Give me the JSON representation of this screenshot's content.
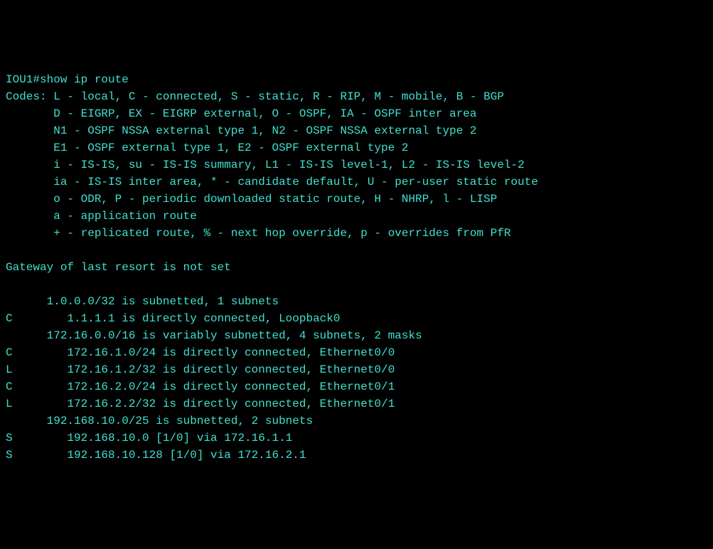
{
  "prompt": "IOU1#",
  "command": "show ip route",
  "codes_header": "Codes: L - local, C - connected, S - static, R - RIP, M - mobile, B - BGP",
  "codes": [
    "       D - EIGRP, EX - EIGRP external, O - OSPF, IA - OSPF inter area",
    "       N1 - OSPF NSSA external type 1, N2 - OSPF NSSA external type 2",
    "       E1 - OSPF external type 1, E2 - OSPF external type 2",
    "       i - IS-IS, su - IS-IS summary, L1 - IS-IS level-1, L2 - IS-IS level-2",
    "       ia - IS-IS inter area, * - candidate default, U - per-user static route",
    "       o - ODR, P - periodic downloaded static route, H - NHRP, l - LISP",
    "       a - application route",
    "       + - replicated route, % - next hop override, p - overrides from PfR"
  ],
  "gateway_line": "Gateway of last resort is not set",
  "routes": [
    "      1.0.0.0/32 is subnetted, 1 subnets",
    "C        1.1.1.1 is directly connected, Loopback0",
    "      172.16.0.0/16 is variably subnetted, 4 subnets, 2 masks",
    "C        172.16.1.0/24 is directly connected, Ethernet0/0",
    "L        172.16.1.2/32 is directly connected, Ethernet0/0",
    "C        172.16.2.0/24 is directly connected, Ethernet0/1",
    "L        172.16.2.2/32 is directly connected, Ethernet0/1",
    "      192.168.10.0/25 is subnetted, 2 subnets",
    "S        192.168.10.0 [1/0] via 172.16.1.1",
    "S        192.168.10.128 [1/0] via 172.16.2.1"
  ]
}
